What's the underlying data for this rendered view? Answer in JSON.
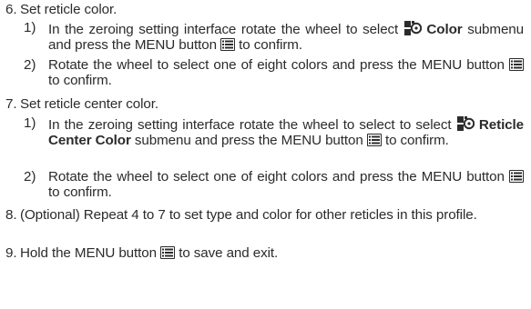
{
  "steps": [
    {
      "num": "6.",
      "title": "Set reticle color.",
      "subs": [
        {
          "num": "1)",
          "pre": "In the zeroing setting interface rotate the wheel to select",
          "bold": "Color",
          "post": "submenu and press the MENU button",
          "end": "to confirm."
        },
        {
          "num": "2)",
          "pre": "Rotate the wheel to select one of eight colors and press the MENU button",
          "end": "to confirm."
        }
      ]
    },
    {
      "num": "7.",
      "title": "Set reticle center color.",
      "subs": [
        {
          "num": "1)",
          "pre": "In the zeroing setting interface rotate the wheel to select to select",
          "bold": "Reticle Center Color",
          "post": "submenu and press the MENU button",
          "end": "to confirm."
        },
        {
          "num": "2)",
          "pre": "Rotate the wheel to select one of eight colors and press the MENU button",
          "end": "to confirm."
        }
      ]
    },
    {
      "num": "8.",
      "title": "(Optional) Repeat 4 to 7 to set type and color for other reticles in this profile."
    },
    {
      "num": "9.",
      "pre": "Hold the MENU button",
      "end": "to save and exit."
    }
  ],
  "icons": {
    "reticle": "reticle-color-icon",
    "menu": "menu-button-icon"
  }
}
